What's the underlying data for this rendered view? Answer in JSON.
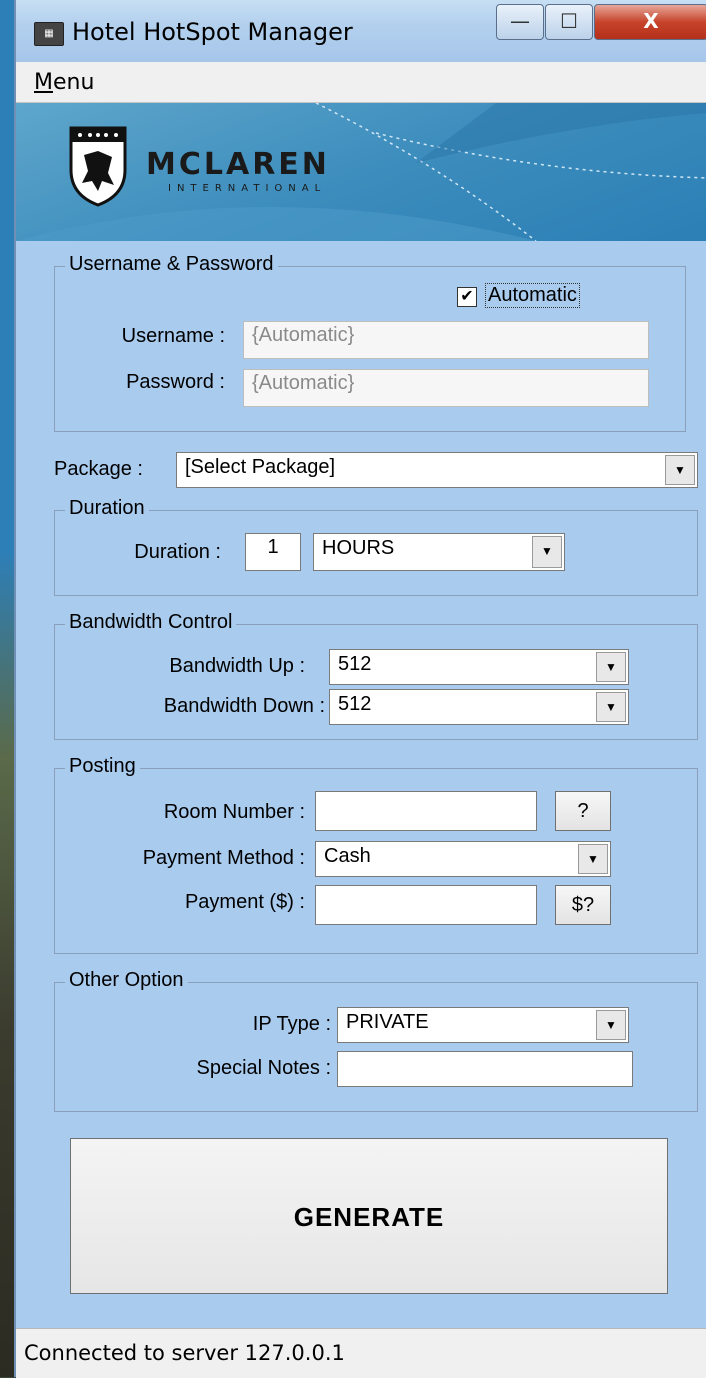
{
  "window": {
    "title": "Hotel HotSpot Manager",
    "icon_name": "app-icon",
    "minimize_glyph": "—",
    "maximize_glyph": "☐",
    "close_glyph": "X"
  },
  "menu": {
    "label": "Menu"
  },
  "banner": {
    "brand": "MCLAREN",
    "brand_sub": "INTERNATIONAL"
  },
  "credentials": {
    "legend": "Username & Password",
    "automatic_label": "Automatic",
    "automatic_checked": true,
    "username_label": "Username :",
    "username_value": "{Automatic}",
    "password_label": "Password :",
    "password_value": "{Automatic}"
  },
  "package": {
    "label": "Package :",
    "value": "[Select Package]"
  },
  "duration": {
    "legend": "Duration",
    "label": "Duration :",
    "amount": "1",
    "unit": "HOURS"
  },
  "bandwidth": {
    "legend": "Bandwidth Control",
    "up_label": "Bandwidth Up :",
    "up_value": "512",
    "down_label": "Bandwidth Down :",
    "down_value": "512"
  },
  "posting": {
    "legend": "Posting",
    "room_label": "Room Number :",
    "room_value": "",
    "room_button": "?",
    "method_label": "Payment Method :",
    "method_value": "Cash",
    "payment_label": "Payment ($) :",
    "payment_value": "",
    "payment_button": "$?"
  },
  "other": {
    "legend": "Other Option",
    "ip_label": "IP Type :",
    "ip_value": "PRIVATE",
    "notes_label": "Special Notes :",
    "notes_value": ""
  },
  "generate_label": "GENERATE",
  "status": "Connected to server 127.0.0.1",
  "colors": {
    "form_bg": "#a9cbee",
    "banner_bg": "#3d8dbd",
    "close_red": "#c7442b"
  }
}
